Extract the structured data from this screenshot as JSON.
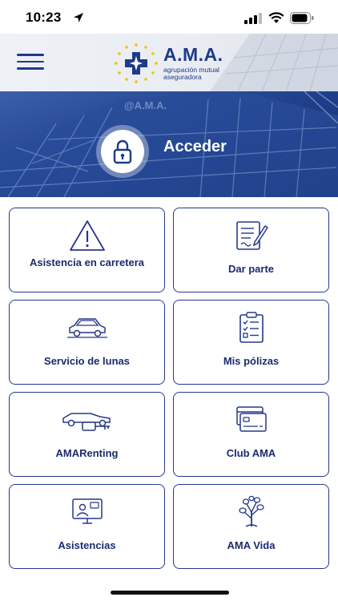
{
  "status_bar": {
    "time": "10:23"
  },
  "header": {
    "logo_title": "A.M.A.",
    "logo_subtitle_1": "agrupación mutual",
    "logo_subtitle_2": "aseguradora"
  },
  "hero": {
    "login_label": "Acceder"
  },
  "tiles": [
    {
      "label": "Asistencia en carretera",
      "icon": "warning-triangle-icon"
    },
    {
      "label": "Dar parte",
      "icon": "form-pen-icon"
    },
    {
      "label": "Servicio de lunas",
      "icon": "car-windshield-icon"
    },
    {
      "label": "Mis pólizas",
      "icon": "checklist-clipboard-icon"
    },
    {
      "label": "AMARenting",
      "icon": "car-key-icon"
    },
    {
      "label": "Club AMA",
      "icon": "cards-icon"
    },
    {
      "label": "Asistencias",
      "icon": "video-consult-icon"
    },
    {
      "label": "AMA Vida",
      "icon": "tree-icon"
    }
  ],
  "colors": {
    "primary": "#1e3a8a",
    "tile_border": "#25388a",
    "hero_bg": "#1a3a86"
  }
}
